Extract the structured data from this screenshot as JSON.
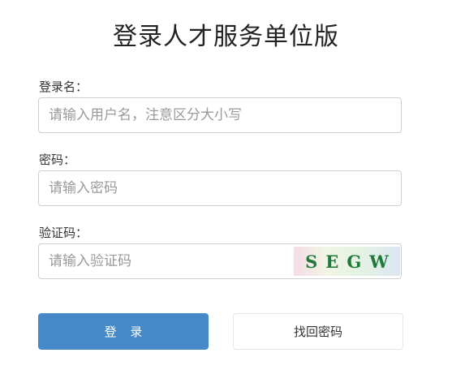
{
  "title": "登录人才服务单位版",
  "form": {
    "username": {
      "label": "登录名：",
      "placeholder": "请输入用户名，注意区分大小写",
      "value": ""
    },
    "password": {
      "label": "密码：",
      "placeholder": "请输入密码",
      "value": ""
    },
    "captcha": {
      "label": "验证码：",
      "placeholder": "请输入验证码",
      "value": "",
      "image_text": "SEGW"
    }
  },
  "buttons": {
    "login": "登 录",
    "recover_password": "找回密码"
  },
  "colors": {
    "primary_button": "#4689c9",
    "captcha_text": "#1f7a3a"
  }
}
